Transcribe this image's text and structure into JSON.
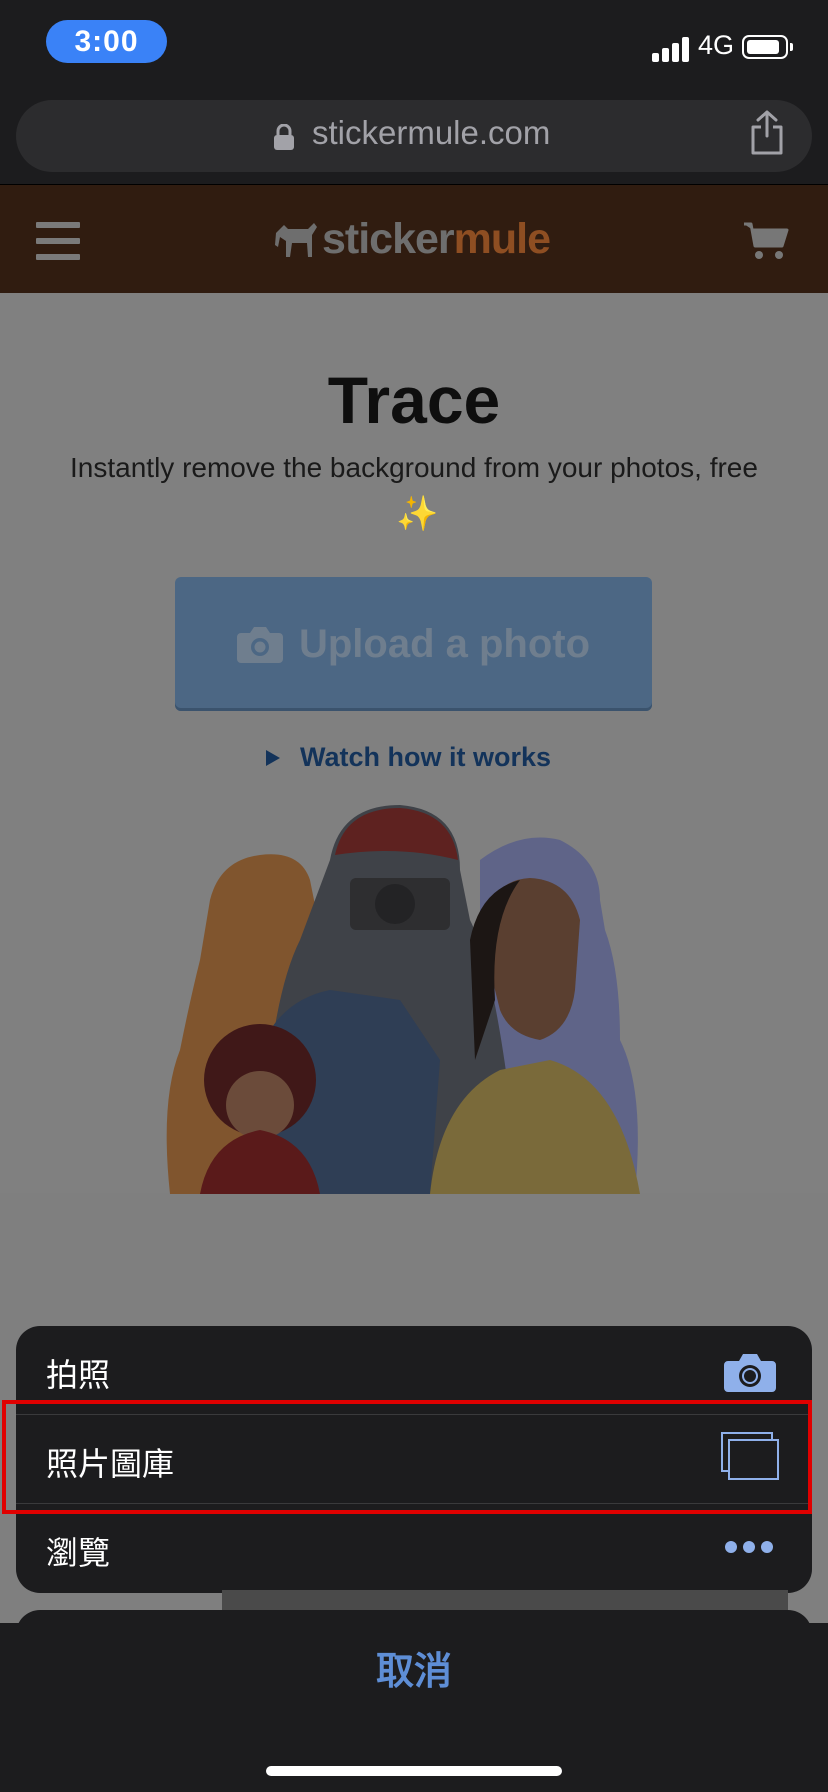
{
  "status_bar": {
    "time": "3:00",
    "network": "4G",
    "battery_level": 0.9
  },
  "browser": {
    "url": "stickermule.com"
  },
  "site": {
    "logo_part1": "sticker",
    "logo_part2": "mule",
    "title": "Trace",
    "subtitle": "Instantly remove the background from your photos, free",
    "upload_button": "Upload a photo",
    "watch_link": "Watch how it works"
  },
  "action_sheet": {
    "items": [
      {
        "label": "拍照",
        "icon": "camera-icon"
      },
      {
        "label": "照片圖庫",
        "icon": "photo-library-icon"
      },
      {
        "label": "瀏覽",
        "icon": "more-icon"
      }
    ],
    "cancel": "取消"
  },
  "colors": {
    "accent_blue": "#5e8ed6",
    "highlight_red": "#e00000",
    "upload_button": "#4c6784",
    "logo_mule": "#8e4e22"
  }
}
